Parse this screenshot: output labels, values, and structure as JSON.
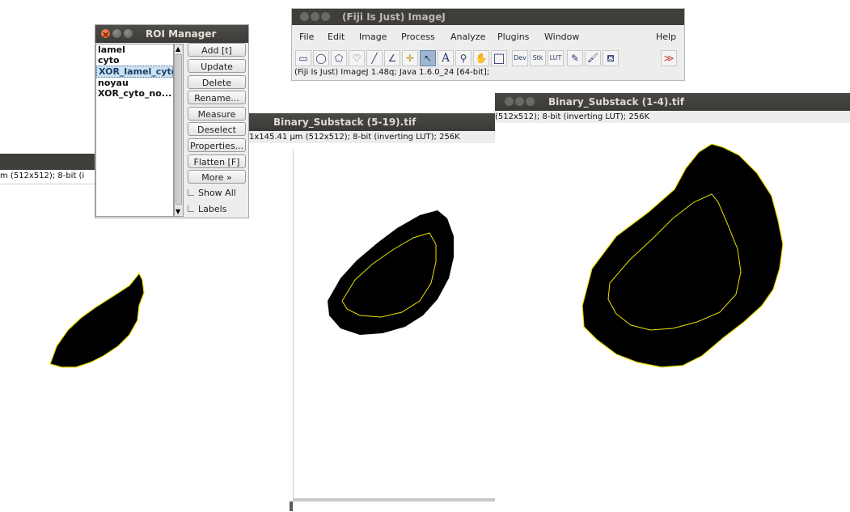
{
  "roi_manager": {
    "title": "ROI Manager",
    "items": [
      "lamel",
      "cyto",
      "XOR_lamel_cyto",
      "noyau",
      "XOR_cyto_no..."
    ],
    "selected_index": 2,
    "buttons": [
      "Add [t]",
      "Update",
      "Delete",
      "Rename...",
      "Measure",
      "Deselect",
      "Properties...",
      "Flatten [F]",
      "More »"
    ],
    "checkboxes": [
      "Show All",
      "Labels"
    ]
  },
  "imagej": {
    "title": "(Fiji Is Just) ImageJ",
    "menu": [
      "File",
      "Edit",
      "Image",
      "Process",
      "Analyze",
      "Plugins",
      "Window",
      "Help"
    ],
    "tools": [
      {
        "icon": "rectangle-tool-icon",
        "glyph": "▭"
      },
      {
        "icon": "oval-tool-icon",
        "glyph": "◯"
      },
      {
        "icon": "polygon-tool-icon",
        "glyph": "⬠"
      },
      {
        "icon": "freehand-tool-icon",
        "glyph": "♡"
      },
      {
        "icon": "line-tool-icon",
        "glyph": "╱"
      },
      {
        "icon": "angle-tool-icon",
        "glyph": "∠"
      },
      {
        "icon": "point-tool-icon",
        "glyph": "✛"
      },
      {
        "icon": "wand-tool-icon",
        "glyph": "↖"
      },
      {
        "icon": "text-tool-icon",
        "glyph": "A"
      },
      {
        "icon": "magnifier-tool-icon",
        "glyph": "⚲"
      },
      {
        "icon": "scroll-tool-icon",
        "glyph": "✋"
      },
      {
        "icon": "color-picker-icon",
        "glyph": "□"
      },
      {
        "icon": "dev-menu-icon",
        "glyph": "Dev"
      },
      {
        "icon": "stk-menu-icon",
        "glyph": "Stk"
      },
      {
        "icon": "lut-menu-icon",
        "glyph": "LUT"
      },
      {
        "icon": "pencil-tool-icon",
        "glyph": "✎"
      },
      {
        "icon": "brush-tool-icon",
        "glyph": "🖌"
      },
      {
        "icon": "flood-fill-icon",
        "glyph": "⛾"
      },
      {
        "icon": "more-tools-icon",
        "glyph": "≫"
      }
    ],
    "status": "(Fiji Is Just) ImageJ 1.48q; Java 1.6.0_24 [64-bit];"
  },
  "windows": {
    "substack_5_19": {
      "title": "Binary_Substack (5-19).tif",
      "info": "1x145.41 µm (512x512); 8-bit (inverting LUT); 256K"
    },
    "substack_1_4": {
      "title": "Binary_Substack (1-4).tif",
      "info": "(512x512); 8-bit (inverting LUT); 256K"
    },
    "left_window": {
      "info": "m (512x512); 8-bit (i"
    }
  },
  "colors": {
    "titlebar": "#3f3e3a",
    "roi_outline": "#e8e000",
    "blob": "#000000"
  }
}
